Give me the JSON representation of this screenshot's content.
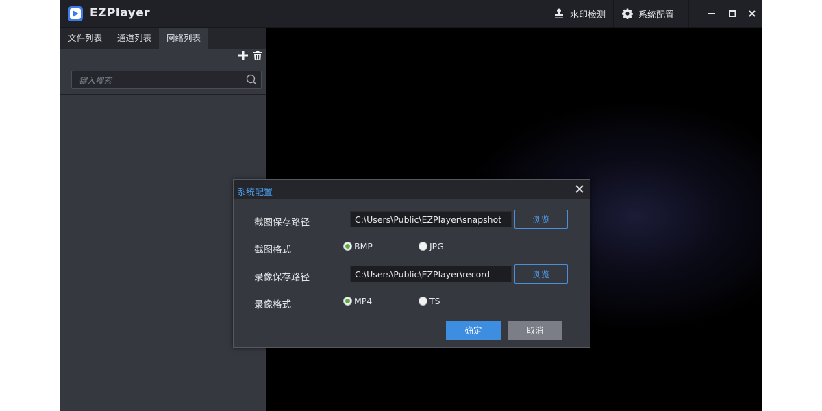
{
  "app": {
    "title": "EZPlayer",
    "brand_color": "#3d7bea"
  },
  "titlebar": {
    "watermark_label": "水印检测",
    "settings_label": "系统配置",
    "minimize_icon": "minimize-icon",
    "maximize_icon": "maximize-icon",
    "close_icon": "close-icon"
  },
  "sidebar": {
    "tabs": [
      {
        "label": "文件列表",
        "active": false
      },
      {
        "label": "通道列表",
        "active": false
      },
      {
        "label": "网络列表",
        "active": true
      }
    ],
    "add_icon": "plus-icon",
    "delete_icon": "trash-icon",
    "search": {
      "placeholder": "键入搜索",
      "value": ""
    }
  },
  "dialog": {
    "title": "系统配置",
    "snapshot_path_label": "截图保存路径",
    "snapshot_path_value": "C:\\Users\\Public\\EZPlayer\\snapshot",
    "snapshot_browse": "浏览",
    "snapshot_format_label": "截图格式",
    "snapshot_formats": [
      {
        "label": "BMP",
        "checked": true
      },
      {
        "label": "JPG",
        "checked": false
      }
    ],
    "record_path_label": "录像保存路径",
    "record_path_value": "C:\\Users\\Public\\EZPlayer\\record",
    "record_browse": "浏览",
    "record_format_label": "录像格式",
    "record_formats": [
      {
        "label": "MP4",
        "checked": true
      },
      {
        "label": "TS",
        "checked": false
      }
    ],
    "ok_label": "确定",
    "cancel_label": "取消"
  },
  "colors": {
    "accent": "#4a9be8",
    "ok_button": "#3d8de0",
    "radio_checked": "#5cae3c"
  }
}
